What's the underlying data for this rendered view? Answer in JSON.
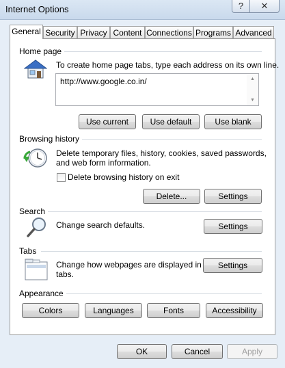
{
  "window": {
    "title": "Internet Options",
    "help_glyph": "?",
    "close_glyph": "✕"
  },
  "tabs": [
    {
      "label": "General"
    },
    {
      "label": "Security"
    },
    {
      "label": "Privacy"
    },
    {
      "label": "Content"
    },
    {
      "label": "Connections"
    },
    {
      "label": "Programs"
    },
    {
      "label": "Advanced"
    }
  ],
  "home_page": {
    "section_label": "Home page",
    "description": "To create home page tabs, type each address on its own line.",
    "url_value": "http://www.google.co.in/",
    "buttons": {
      "use_current": "Use current",
      "use_default": "Use default",
      "use_blank": "Use blank"
    }
  },
  "browsing_history": {
    "section_label": "Browsing history",
    "description_line1": "Delete temporary files, history, cookies, saved passwords,",
    "description_line2": "and web form information.",
    "checkbox_label": "Delete browsing history on exit",
    "checkbox_checked": false,
    "buttons": {
      "delete": "Delete...",
      "settings": "Settings"
    }
  },
  "search": {
    "section_label": "Search",
    "description": "Change search defaults.",
    "settings_label": "Settings"
  },
  "tabs_section": {
    "section_label": "Tabs",
    "description_line1": "Change how webpages are displayed in",
    "description_line2": "tabs.",
    "settings_label": "Settings"
  },
  "appearance": {
    "section_label": "Appearance",
    "buttons": {
      "colors": "Colors",
      "languages": "Languages",
      "fonts": "Fonts",
      "accessibility": "Accessibility"
    }
  },
  "dialog_buttons": {
    "ok": "OK",
    "cancel": "Cancel",
    "apply": "Apply",
    "apply_enabled": false
  },
  "colors": {
    "window_bg": "#e6eef7",
    "panel_bg": "#ffffff",
    "accent_blue": "#3a6fc4"
  }
}
